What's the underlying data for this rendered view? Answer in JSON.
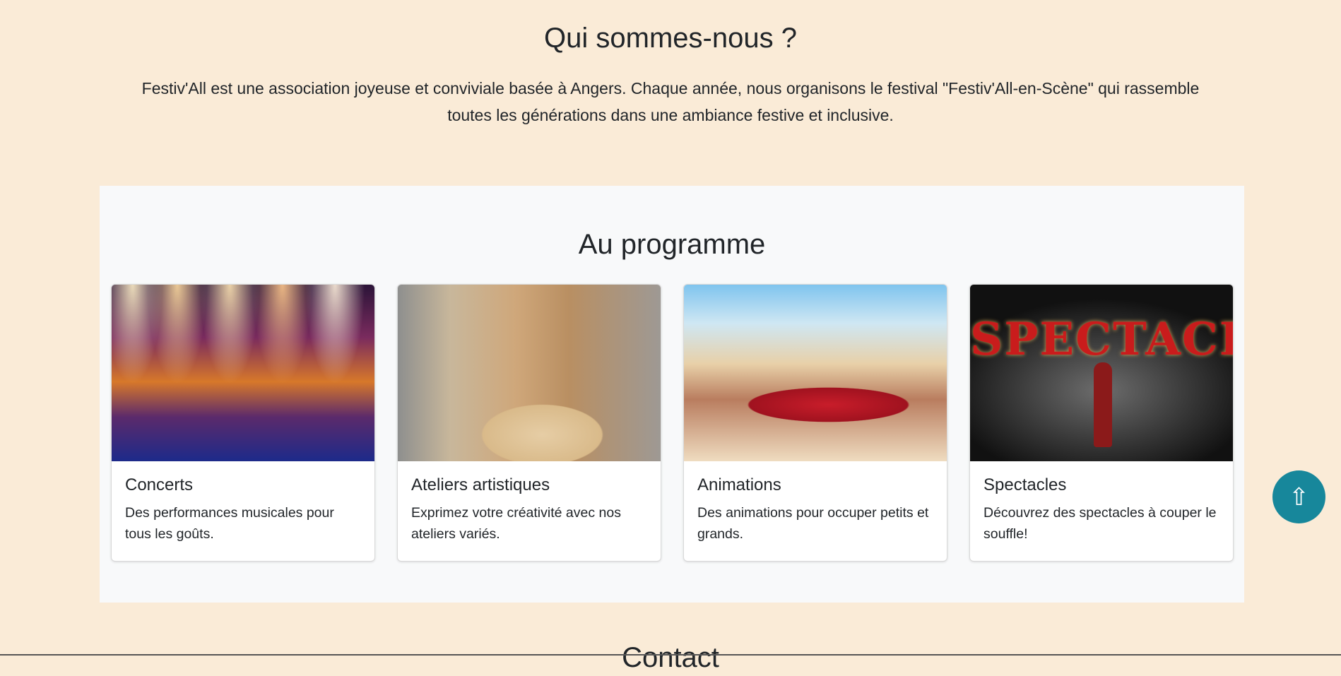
{
  "about": {
    "title": "Qui sommes-nous ?",
    "text": "Festiv'All est une association joyeuse et conviviale basée à Angers. Chaque année, nous organisons le festival \"Festiv'All-en-Scène\" qui rassemble toutes les générations dans une ambiance festive et inclusive."
  },
  "programme": {
    "title": "Au programme",
    "cards": [
      {
        "title": "Concerts",
        "text": "Des performances musicales pour tous les goûts.",
        "image": "concert-stage-photo"
      },
      {
        "title": "Ateliers artistiques",
        "text": "Exprimez votre créativité avec nos ateliers variés.",
        "image": "woodworking-workshop-photo"
      },
      {
        "title": "Animations",
        "text": "Des animations pour occuper petits et grands.",
        "image": "crowd-animation-illustration"
      },
      {
        "title": "Spectacles",
        "text": "Découvrez des spectacles à couper le souffle!",
        "image": "spectacle-sign-photo"
      }
    ]
  },
  "spectacle_sign": "SPECTACLE!",
  "scroll_top": {
    "label": "⇧"
  },
  "next_section": {
    "title": "Contact"
  },
  "colors": {
    "page_background": "#faebd7",
    "section_background": "#f8f9fa",
    "scroll_button": "#17879b"
  }
}
